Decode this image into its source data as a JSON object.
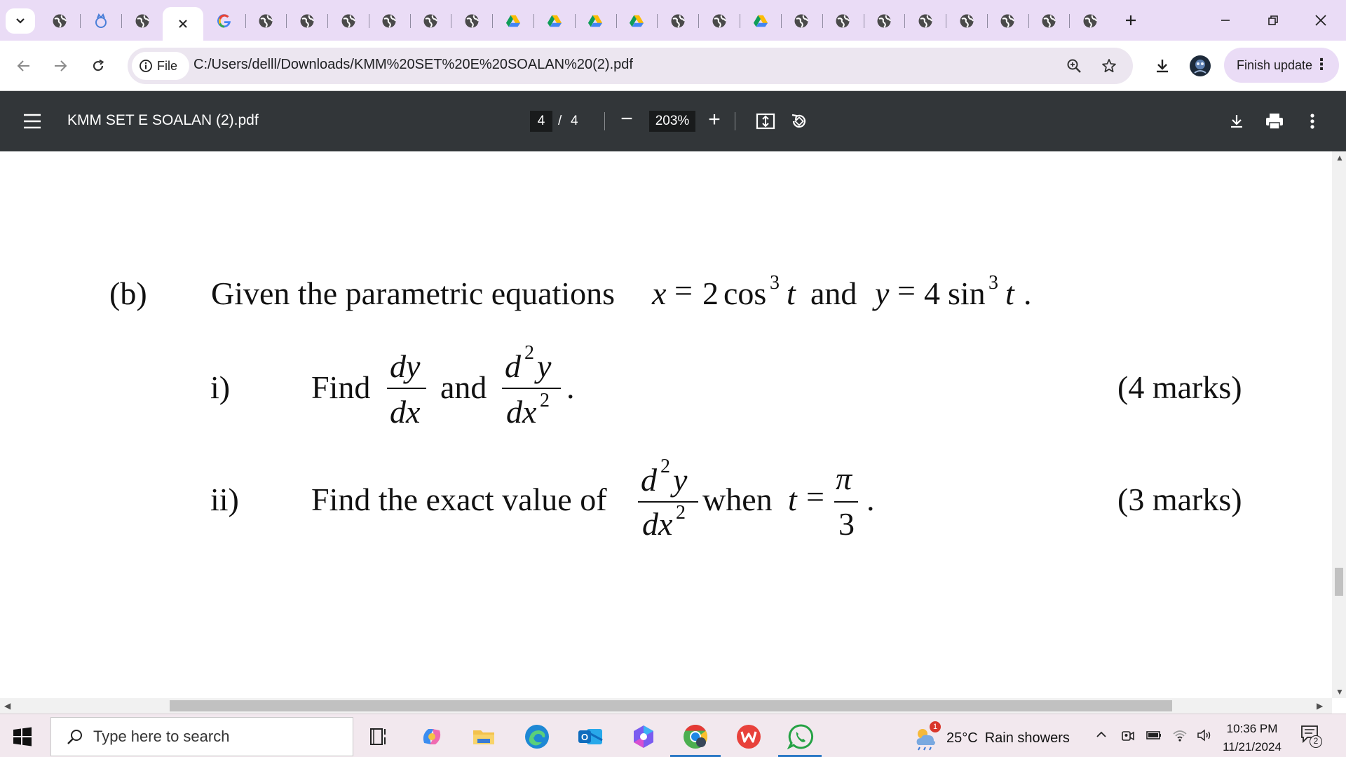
{
  "tabs": [
    {
      "icon": "globe-icon"
    },
    {
      "icon": "cat-logo-icon"
    },
    {
      "icon": "globe-icon"
    },
    {
      "icon": "close-icon",
      "active": true
    },
    {
      "icon": "google-icon"
    },
    {
      "icon": "globe-icon"
    },
    {
      "icon": "globe-icon"
    },
    {
      "icon": "globe-icon"
    },
    {
      "icon": "globe-icon"
    },
    {
      "icon": "globe-icon"
    },
    {
      "icon": "globe-icon"
    },
    {
      "icon": "drive-icon"
    },
    {
      "icon": "drive-icon"
    },
    {
      "icon": "drive-icon"
    },
    {
      "icon": "drive-icon"
    },
    {
      "icon": "globe-icon"
    },
    {
      "icon": "globe-icon"
    },
    {
      "icon": "drive-icon"
    },
    {
      "icon": "globe-icon"
    },
    {
      "icon": "globe-icon"
    },
    {
      "icon": "globe-icon"
    },
    {
      "icon": "globe-icon"
    },
    {
      "icon": "globe-icon"
    },
    {
      "icon": "globe-icon"
    },
    {
      "icon": "globe-icon"
    },
    {
      "icon": "globe-icon"
    }
  ],
  "addressbar": {
    "chip_label": "File",
    "url": "C:/Users/delll/Downloads/KMM%20SET%20E%20SOALAN%20(2).pdf",
    "finish_update": "Finish update"
  },
  "pdf_toolbar": {
    "title": "KMM SET E SOALAN (2).pdf",
    "current_page": "4",
    "page_sep": "/",
    "total_pages": "4",
    "zoom": "203%",
    "zoom_out": "−",
    "zoom_in": "+"
  },
  "document": {
    "part_b": {
      "label": "(b)",
      "intro": "Given the parametric equations",
      "x_lhs": "x",
      "eq": "=",
      "x_coef": "2",
      "x_fn": "cos",
      "x_exp": "3",
      "x_var": "t",
      "and": "and",
      "y_lhs": "y",
      "y_coef": "4",
      "y_fn": "sin",
      "y_exp": "3",
      "y_var": "t",
      "end_dot": "."
    },
    "q1": {
      "label": "i)",
      "find": "Find",
      "dy": "dy",
      "dx": "dx",
      "and": "and",
      "d2y_d": "d",
      "d2y_exp": "2",
      "d2y_y": "y",
      "dx2_dx": "dx",
      "dx2_exp": "2",
      "dot": ".",
      "marks": "(4 marks)"
    },
    "q2": {
      "label": "ii)",
      "text": "Find the exact value of",
      "d2y_d": "d",
      "d2y_exp": "2",
      "d2y_y": "y",
      "dx2_dx": "dx",
      "dx2_exp": "2",
      "when": "when",
      "t": "t",
      "eq": "=",
      "pi": "π",
      "three": "3",
      "dot": ".",
      "marks": "(3 marks)"
    }
  },
  "taskbar": {
    "search_placeholder": "Type here to search",
    "weather_temp": "25°C",
    "weather_desc": "Rain showers",
    "weather_badge": "1",
    "time": "10:36 PM",
    "date": "11/21/2024",
    "notif_count": "2"
  },
  "colors": {
    "tabstrip": "#eadcf6",
    "omnibox": "#ece6f0",
    "pdf_toolbar": "#323639",
    "taskbar": "#f2e8ee",
    "accent": "#2b78c5"
  }
}
